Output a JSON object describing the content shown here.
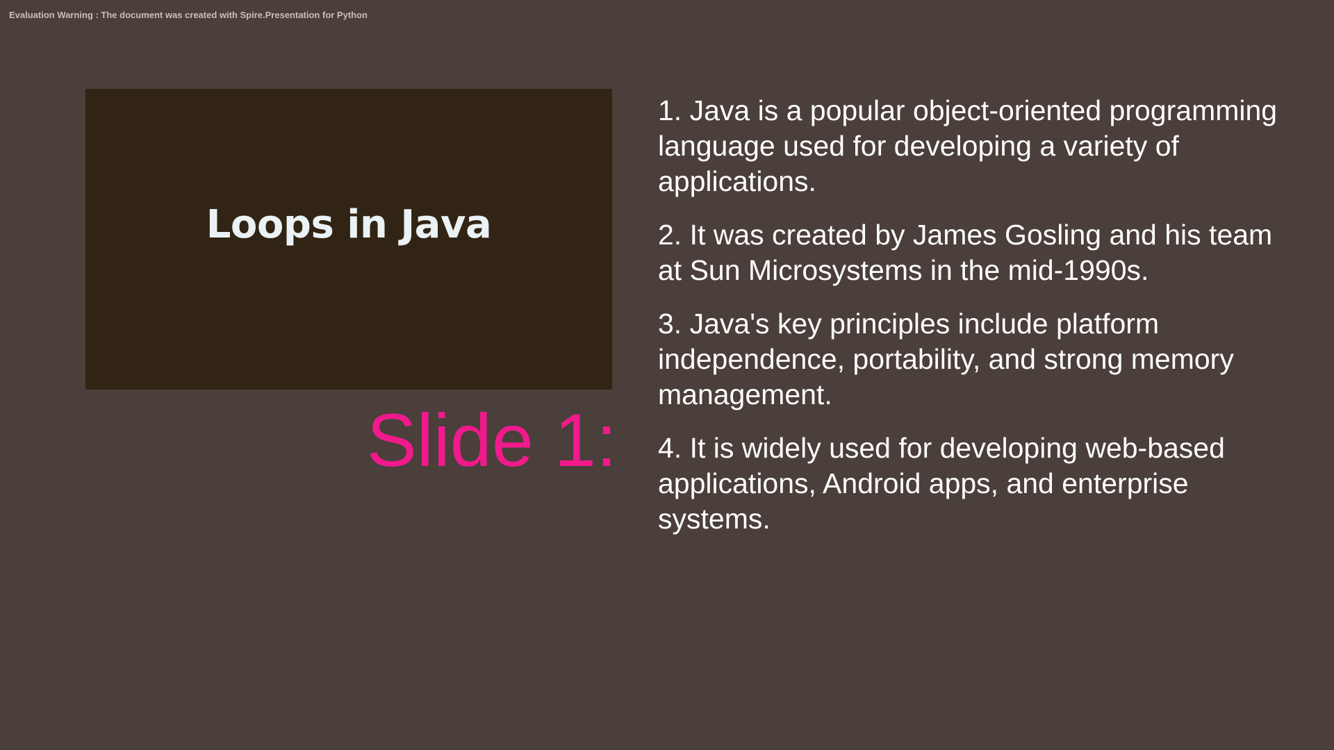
{
  "warning": "Evaluation Warning : The document was created with Spire.Presentation for Python",
  "title": "Loops in Java",
  "slide_label": "Slide 1:",
  "points": [
    "1. Java is a popular object-oriented programming language used for developing a variety of applications.",
    "2. It was created by James Gosling and his team at Sun Microsystems in the mid-1990s.",
    "3. Java's key principles include platform independence, portability, and strong memory management.",
    "4. It is widely used for developing web-based applications, Android apps, and enterprise systems."
  ],
  "colors": {
    "background": "#4a3f3a",
    "title_box": "#322414",
    "title_text": "#eaf2f5",
    "slide_label": "#f01a8c",
    "body_text": "#ffffff"
  }
}
